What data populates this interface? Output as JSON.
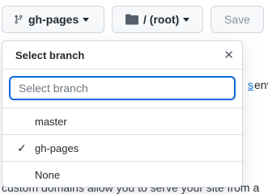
{
  "toolbar": {
    "branch_label": "gh-pages",
    "folder_label": "/ (root)",
    "save_label": "Save"
  },
  "background": {
    "link_fragment": "s",
    "text_fragment": "env",
    "bottom_line": "custom domains allow you to serve your site from a"
  },
  "dropdown": {
    "title": "Select branch",
    "filter_placeholder": "Select branch",
    "filter_value": "",
    "items": [
      {
        "label": "master",
        "selected": false
      },
      {
        "label": "gh-pages",
        "selected": true
      },
      {
        "label": "None",
        "selected": false
      }
    ]
  },
  "colors": {
    "accent": "#0969da",
    "border": "#d0d7de",
    "button_bg": "#f6f8fa"
  }
}
